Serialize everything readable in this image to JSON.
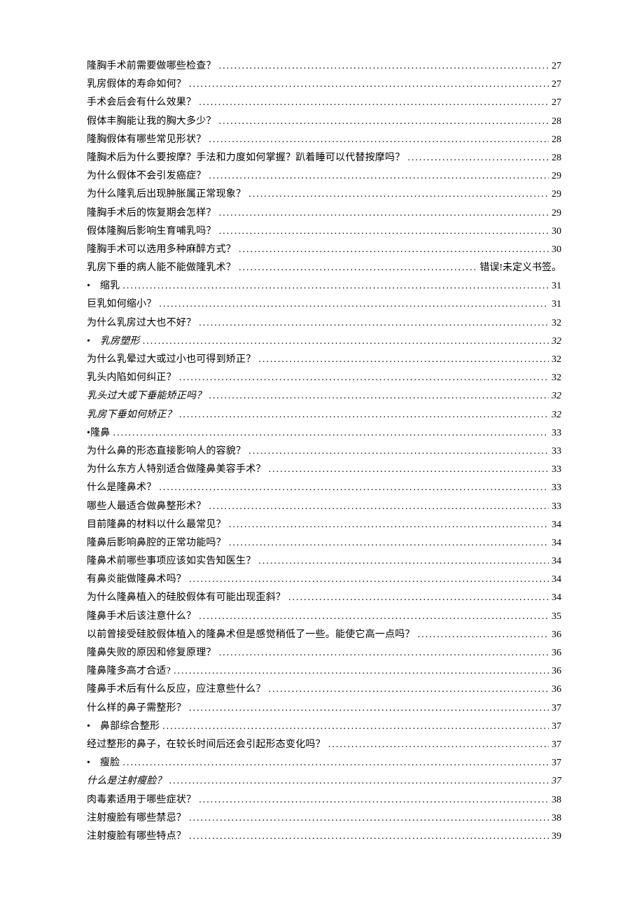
{
  "toc": [
    {
      "text": "隆胸手术前需要做哪些检查？",
      "page": "27"
    },
    {
      "text": "乳房假体的寿命如何？",
      "page": "27"
    },
    {
      "text": "手术会后会有什么效果？",
      "page": "27"
    },
    {
      "text": "假体丰胸能让我的胸大多少？",
      "page": "28"
    },
    {
      "text": "隆胸假体有哪些常见形状？",
      "page": "28"
    },
    {
      "text": "隆胸术后为什么要按摩？手法和力度如何掌握？趴着睡可以代替按摩吗？",
      "page": "28"
    },
    {
      "text": "为什么假体不会引发癌症？",
      "page": "29"
    },
    {
      "text": "为什么隆乳后出现肿胀属正常现象？",
      "page": "29"
    },
    {
      "text": "隆胸手术后的恢复期会怎样？",
      "page": "29"
    },
    {
      "text": "假体隆胸后影响生育哺乳吗？",
      "page": "30"
    },
    {
      "text": "隆胸手术可以选用多种麻醉方式？",
      "page": "30"
    },
    {
      "text": "乳房下垂的病人能不能做隆乳术？",
      "page": "错误!未定义书签。"
    },
    {
      "text": "缩乳",
      "page": "31",
      "bullet": true
    },
    {
      "text": "巨乳如何缩小？",
      "page": "31"
    },
    {
      "text": "为什么乳房过大也不好？",
      "page": "32"
    },
    {
      "text": "乳房塑形",
      "page": "32",
      "bullet": true,
      "italic": true
    },
    {
      "text": "为什么乳晕过大或过小也可得到矫正？",
      "page": "32"
    },
    {
      "text": "乳头内陷如何纠正？",
      "page": "32"
    },
    {
      "text": "乳头过大或下垂能矫正吗？",
      "page": "32",
      "italic": true
    },
    {
      "text": "乳房下垂如何矫正？",
      "page": "32",
      "italic": true
    },
    {
      "text": "•隆鼻",
      "page": "33",
      "raw": true
    },
    {
      "text": "为什么鼻的形态直接影响人的容貌？",
      "page": "33"
    },
    {
      "text": "为什么东方人特别适合做隆鼻美容手术？",
      "page": "33"
    },
    {
      "text": "什么是隆鼻术？",
      "page": "33"
    },
    {
      "text": "哪些人最适合做鼻整形术？",
      "page": "33"
    },
    {
      "text": "目前隆鼻的材料以什么最常见？",
      "page": "34"
    },
    {
      "text": "隆鼻后影响鼻腔的正常功能吗？",
      "page": "34"
    },
    {
      "text": "隆鼻术前哪些事项应该如实告知医生？",
      "page": "34"
    },
    {
      "text": "有鼻炎能做隆鼻术吗？",
      "page": "34"
    },
    {
      "text": "为什么隆鼻植入的硅胶假体有可能出现歪斜？",
      "page": "34"
    },
    {
      "text": "隆鼻手术后该注意什么？",
      "page": "35"
    },
    {
      "text": "以前曾接受硅胶假体植入的隆鼻术但是感觉稍低了一些。能使它高一点吗？",
      "page": "36"
    },
    {
      "text": "隆鼻失败的原因和修复原理？",
      "page": "36"
    },
    {
      "text": "隆鼻隆多高才合适?",
      "page": "36"
    },
    {
      "text": "隆鼻手术后有什么反应，应注意些什么？",
      "page": "36"
    },
    {
      "text": "什么样的鼻子需整形？",
      "page": "37"
    },
    {
      "text": "鼻部综合整形",
      "page": "37",
      "bullet": true
    },
    {
      "text": "经过整形的鼻子，在较长时间后还会引起形态变化吗？",
      "page": "37"
    },
    {
      "text": "瘦脸",
      "page": "37",
      "bullet": true
    },
    {
      "text": "什么是注射瘦脸？",
      "page": "37",
      "italic": true
    },
    {
      "text": "肉毒素适用于哪些症状？",
      "page": "38"
    },
    {
      "text": "注射瘦脸有哪些禁忌？",
      "page": "38"
    },
    {
      "text": "注射瘦脸有哪些特点？",
      "page": "39"
    }
  ]
}
